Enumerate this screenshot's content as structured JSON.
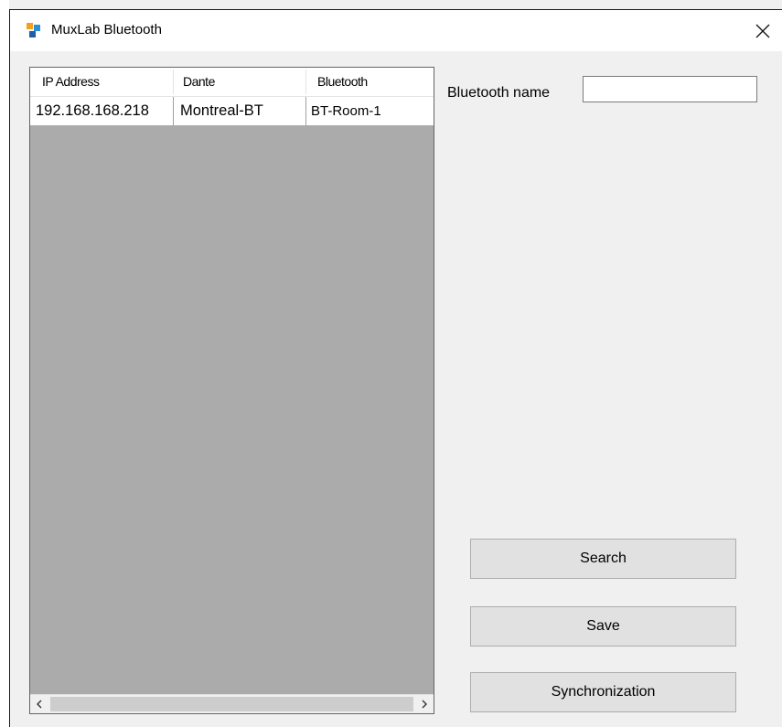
{
  "window": {
    "title": "MuxLab Bluetooth",
    "close_icon": "close-icon"
  },
  "table": {
    "columns": [
      "IP Address",
      "Dante",
      "Bluetooth"
    ],
    "rows": [
      [
        "192.168.168.218",
        "Montreal-BT",
        "BT-Room-1"
      ]
    ],
    "scroll_left_glyph": "<",
    "scroll_right_glyph": ">"
  },
  "form": {
    "bluetooth_name_label": "Bluetooth name",
    "bluetooth_name_value": ""
  },
  "buttons": {
    "search": "Search",
    "save": "Save",
    "synchronization": "Synchronization"
  },
  "colors": {
    "grid_background": "#ababab",
    "window_background": "#f0f0f0",
    "button_background": "#e1e1e1"
  }
}
